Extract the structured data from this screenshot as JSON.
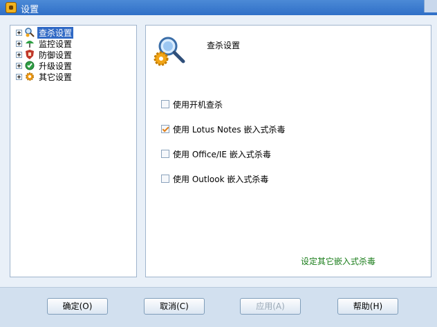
{
  "window": {
    "title": "设置"
  },
  "sidebar": {
    "items": [
      {
        "label": "查杀设置",
        "icon": "scan-search-icon",
        "selected": true
      },
      {
        "label": "监控设置",
        "icon": "umbrella-monitor-icon",
        "selected": false
      },
      {
        "label": "防御设置",
        "icon": "shield-hand-icon",
        "selected": false
      },
      {
        "label": "升级设置",
        "icon": "upgrade-globe-icon",
        "selected": false
      },
      {
        "label": "其它设置",
        "icon": "gear-other-icon",
        "selected": false
      }
    ]
  },
  "main": {
    "title": "查杀设置",
    "options": [
      {
        "label": "使用开机查杀",
        "checked": false
      },
      {
        "label": "使用 Lotus Notes 嵌入式杀毒",
        "checked": true
      },
      {
        "label": "使用 Office/IE 嵌入式杀毒",
        "checked": false
      },
      {
        "label": "使用 Outlook 嵌入式杀毒",
        "checked": false
      }
    ],
    "link_text": "设定其它嵌入式杀毒"
  },
  "footer": {
    "ok": "确定(O)",
    "cancel": "取消(C)",
    "apply": "应用(A)",
    "help": "帮助(H)"
  },
  "colors": {
    "accent": "#316ac5",
    "link": "#1a7d1a",
    "titlebar": "#2f6fc7"
  }
}
